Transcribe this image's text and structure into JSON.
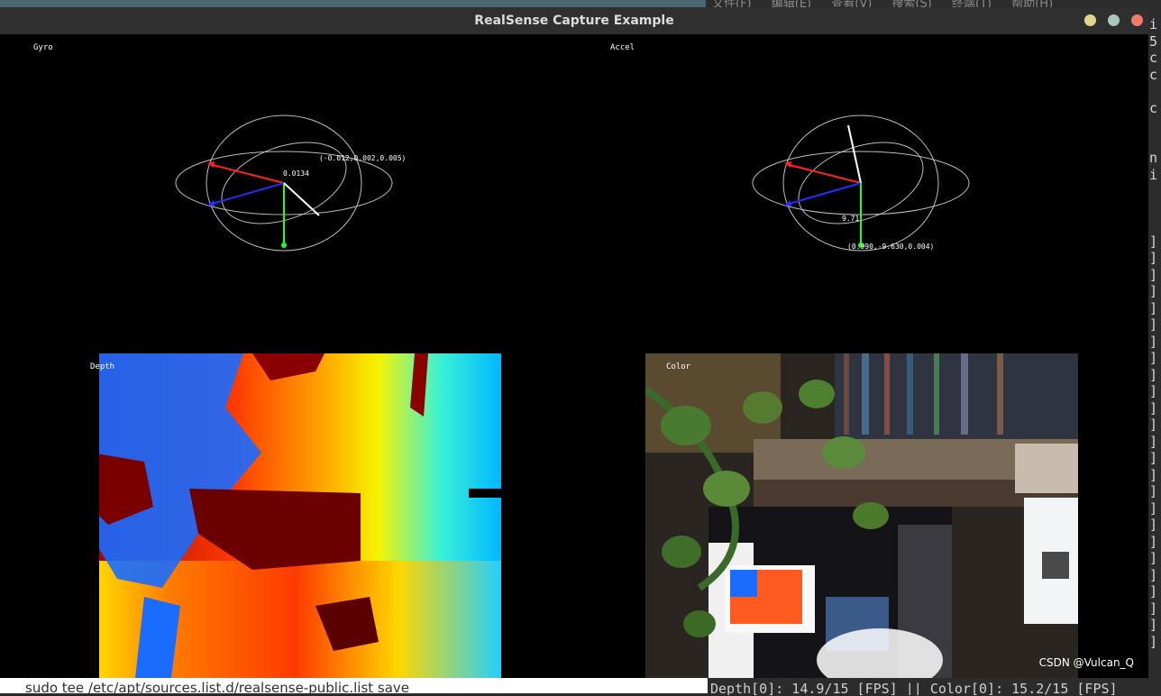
{
  "window": {
    "title": "RealSense Capture Example"
  },
  "gyro": {
    "label": "Gyro",
    "magnitude": "0.0134",
    "vector": "(-0.012,0.002,0.005)"
  },
  "accel": {
    "label": "Accel",
    "magnitude": "9.71",
    "vector": "(0.990,-9.630,0.004)"
  },
  "depth": {
    "label": "Depth"
  },
  "color": {
    "label": "Color"
  },
  "watermark": "CSDN @Vulcan_Q",
  "background": {
    "terminal_menu": [
      "文件(F)",
      "编辑(E)",
      "查看(V)",
      "搜索(S)",
      "终端(T)",
      "帮助(H)"
    ],
    "terminal_side_chars": [
      "i",
      "5",
      "c",
      "c",
      "",
      "c",
      "",
      "",
      "n",
      "i",
      "",
      "",
      "",
      "]",
      "]",
      "]",
      "]",
      "]",
      "]",
      "]",
      "]",
      "]",
      "]",
      "]",
      "]",
      "]",
      "]",
      "]",
      "]",
      "]",
      "]",
      "]",
      "]",
      "]",
      "]",
      "]",
      "]",
      "]"
    ],
    "bottom_left_command": "sudo tee /etc/apt/sources.list.d/realsense-public.list save",
    "bottom_right_status": "Depth[0]: 14.9/15 [FPS] || Color[0]: 15.2/15 [FPS]"
  },
  "colors": {
    "title_bg": "#2f2f2f",
    "x_axis": "#ff2020",
    "y_axis": "#20ff20",
    "z_axis": "#2030ff",
    "vector": "#ffffff",
    "sphere": "#bdbdbd"
  }
}
